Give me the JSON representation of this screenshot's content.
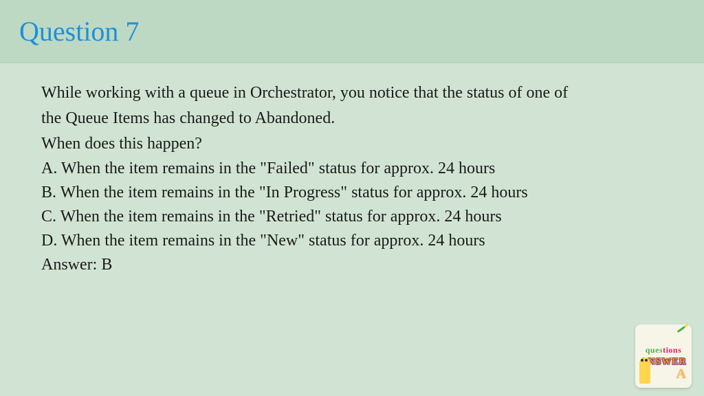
{
  "header": {
    "title": "Question 7"
  },
  "question": {
    "line1": "While working with a queue in Orchestrator, you notice that the status of one of",
    "line2": "the Queue Items has changed to Abandoned.",
    "line3": "When does this happen?",
    "options": {
      "a": "A. When the item remains in the \"Failed\" status for approx. 24 hours",
      "b": "B. When the item remains in the \"In Progress\" status for approx. 24 hours",
      "c": "C. When the item remains in the \"Retried\" status for approx. 24 hours",
      "d": "D. When the item remains in the \"New\" status for approx. 24 hours"
    },
    "answer": "Answer: B"
  },
  "badge": {
    "topText": "questions",
    "midText": "ANSWER",
    "letter": "A"
  }
}
